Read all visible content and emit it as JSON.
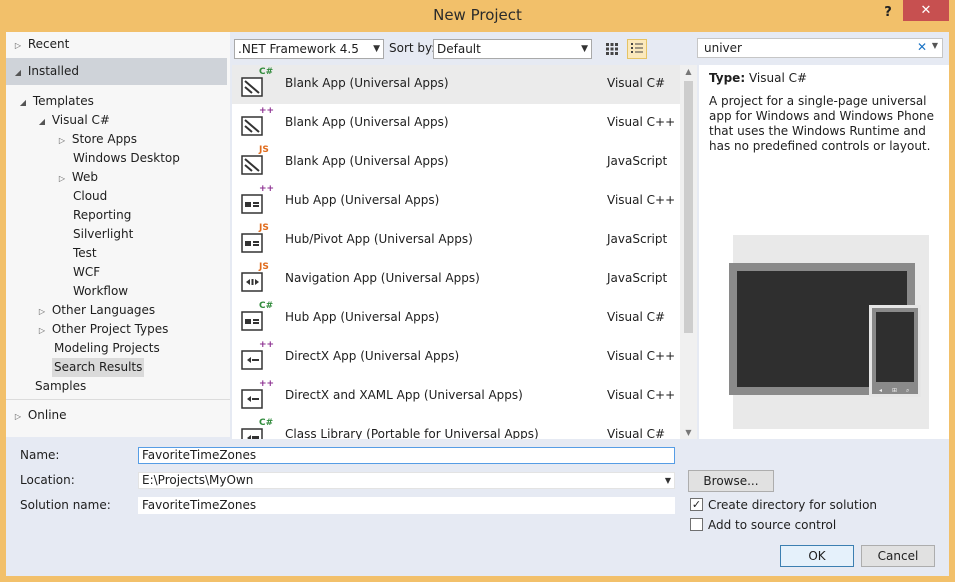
{
  "window": {
    "title": "New Project",
    "help": "?",
    "close": "✕"
  },
  "left_nav": {
    "recent": "Recent",
    "installed": "Installed",
    "templates": "Templates",
    "visual_csharp": "Visual C#",
    "store_apps": "Store Apps",
    "windows_desktop": "Windows Desktop",
    "web": "Web",
    "cloud": "Cloud",
    "reporting": "Reporting",
    "silverlight": "Silverlight",
    "test": "Test",
    "wcf": "WCF",
    "workflow": "Workflow",
    "other_languages": "Other Languages",
    "other_project_types": "Other Project Types",
    "modeling_projects": "Modeling Projects",
    "search_results": "Search Results",
    "samples": "Samples",
    "online": "Online"
  },
  "toolbar": {
    "framework": ".NET Framework 4.5",
    "sort_label": "Sort by:",
    "sort_value": "Default"
  },
  "search": {
    "value": "univer"
  },
  "templates": [
    {
      "name": "Blank App (Universal Apps)",
      "lang": "Visual C#",
      "badge": "C#",
      "badge_color": "#2f8a3a",
      "icon": "blank-app-icon",
      "selected": true
    },
    {
      "name": "Blank App (Universal Apps)",
      "lang": "Visual C++",
      "badge": "++",
      "badge_color": "#8a2c8f",
      "icon": "blank-app-icon",
      "selected": false
    },
    {
      "name": "Blank App (Universal Apps)",
      "lang": "JavaScript",
      "badge": "JS",
      "badge_color": "#e06a1a",
      "icon": "blank-app-icon",
      "selected": false
    },
    {
      "name": "Hub App (Universal Apps)",
      "lang": "Visual C++",
      "badge": "++",
      "badge_color": "#8a2c8f",
      "icon": "hub-app-icon",
      "selected": false
    },
    {
      "name": "Hub/Pivot App (Universal Apps)",
      "lang": "JavaScript",
      "badge": "JS",
      "badge_color": "#e06a1a",
      "icon": "hub-app-icon",
      "selected": false
    },
    {
      "name": "Navigation App (Universal Apps)",
      "lang": "JavaScript",
      "badge": "JS",
      "badge_color": "#e06a1a",
      "icon": "navigation-app-icon",
      "selected": false
    },
    {
      "name": "Hub App (Universal Apps)",
      "lang": "Visual C#",
      "badge": "C#",
      "badge_color": "#2f8a3a",
      "icon": "hub-app-icon",
      "selected": false
    },
    {
      "name": "DirectX App (Universal Apps)",
      "lang": "Visual C++",
      "badge": "++",
      "badge_color": "#8a2c8f",
      "icon": "directx-app-icon",
      "selected": false
    },
    {
      "name": "DirectX and XAML App (Universal Apps)",
      "lang": "Visual C++",
      "badge": "++",
      "badge_color": "#8a2c8f",
      "icon": "directx-app-icon",
      "selected": false
    },
    {
      "name": "Class Library (Portable for Universal Apps)",
      "lang": "Visual C#",
      "badge": "C#",
      "badge_color": "#2f8a3a",
      "icon": "class-library-icon",
      "selected": false
    }
  ],
  "details": {
    "type_label": "Type:",
    "type_value": "Visual C#",
    "description": "A project for a single-page universal app for Windows and Windows Phone that uses the Windows Runtime and has no predefined controls or layout."
  },
  "form": {
    "name_label": "Name:",
    "name_value": "FavoriteTimeZones",
    "location_label": "Location:",
    "location_value": "E:\\Projects\\MyOwn",
    "solution_label": "Solution name:",
    "solution_value": "FavoriteTimeZones",
    "browse": "Browse...",
    "create_dir": "Create directory for solution",
    "create_dir_checked": true,
    "add_source": "Add to source control",
    "add_source_checked": false,
    "ok": "OK",
    "cancel": "Cancel"
  }
}
